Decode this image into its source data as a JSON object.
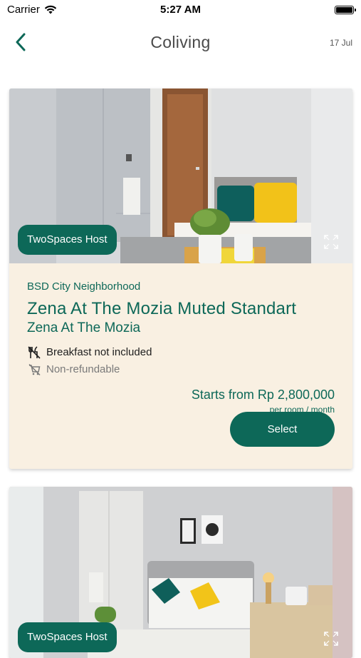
{
  "status_bar": {
    "carrier": "Carrier",
    "time": "5:27 AM"
  },
  "nav": {
    "title": "Coliving",
    "date": "17 Jul",
    "back_icon": "chevron-left-icon"
  },
  "colors": {
    "primary": "#0d6858",
    "card_bg": "#f9f0e2"
  },
  "listings": [
    {
      "host_badge": "TwoSpaces Host",
      "area": "BSD City Neighborhood",
      "room_title": "Zena At The Mozia Muted Standart",
      "property": "Zena At The Mozia",
      "policies": [
        {
          "label": "Breakfast not included",
          "icon": "no-breakfast-icon"
        },
        {
          "label": "Non-refundable",
          "icon": "non-refundable-icon"
        }
      ],
      "price": "Starts from Rp 2,800,000",
      "price_unit": "per room / month",
      "select_label": "Select"
    },
    {
      "host_badge": "TwoSpaces Host"
    }
  ]
}
